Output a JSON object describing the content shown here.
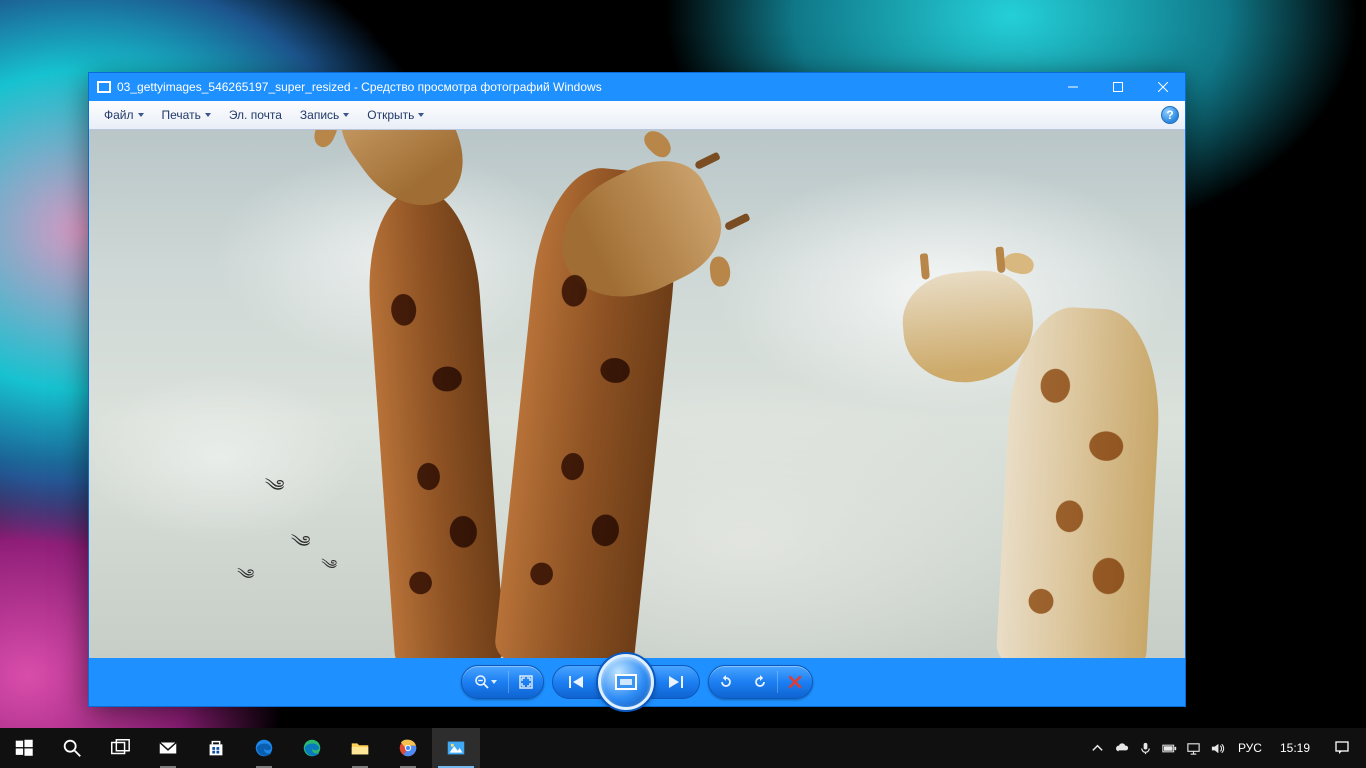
{
  "window": {
    "title": "03_gettyimages_546265197_super_resized - Средство просмотра фотографий Windows",
    "menus": {
      "file": "Файл",
      "print": "Печать",
      "email": "Эл. почта",
      "burn": "Запись",
      "open": "Открыть"
    },
    "help_symbol": "?",
    "controls": {
      "zoom": "zoom-icon",
      "fit": "fit-to-window-icon",
      "prev": "previous-image-icon",
      "slideshow": "slideshow-icon",
      "next": "next-image-icon",
      "rotate_ccw": "rotate-ccw-icon",
      "rotate_cw": "rotate-cw-icon",
      "delete": "delete-icon"
    },
    "image_subject": "Three giraffes against cloudy sky with distant birds"
  },
  "taskbar": {
    "buttons": [
      {
        "name": "start-button"
      },
      {
        "name": "search-button"
      },
      {
        "name": "task-view-button"
      },
      {
        "name": "mail-app"
      },
      {
        "name": "store-app"
      },
      {
        "name": "edge-browser"
      },
      {
        "name": "edge-dev-browser"
      },
      {
        "name": "file-explorer"
      },
      {
        "name": "chrome-browser"
      },
      {
        "name": "photo-viewer-app"
      }
    ],
    "tray": {
      "chevron": "show-hidden-icons",
      "onedrive": "onedrive-icon",
      "microphone": "microphone-icon",
      "battery": "battery-icon",
      "network": "network-icon",
      "volume": "volume-icon"
    },
    "language": "РУС",
    "clock": "15:19",
    "action_center": "action-center-icon"
  }
}
